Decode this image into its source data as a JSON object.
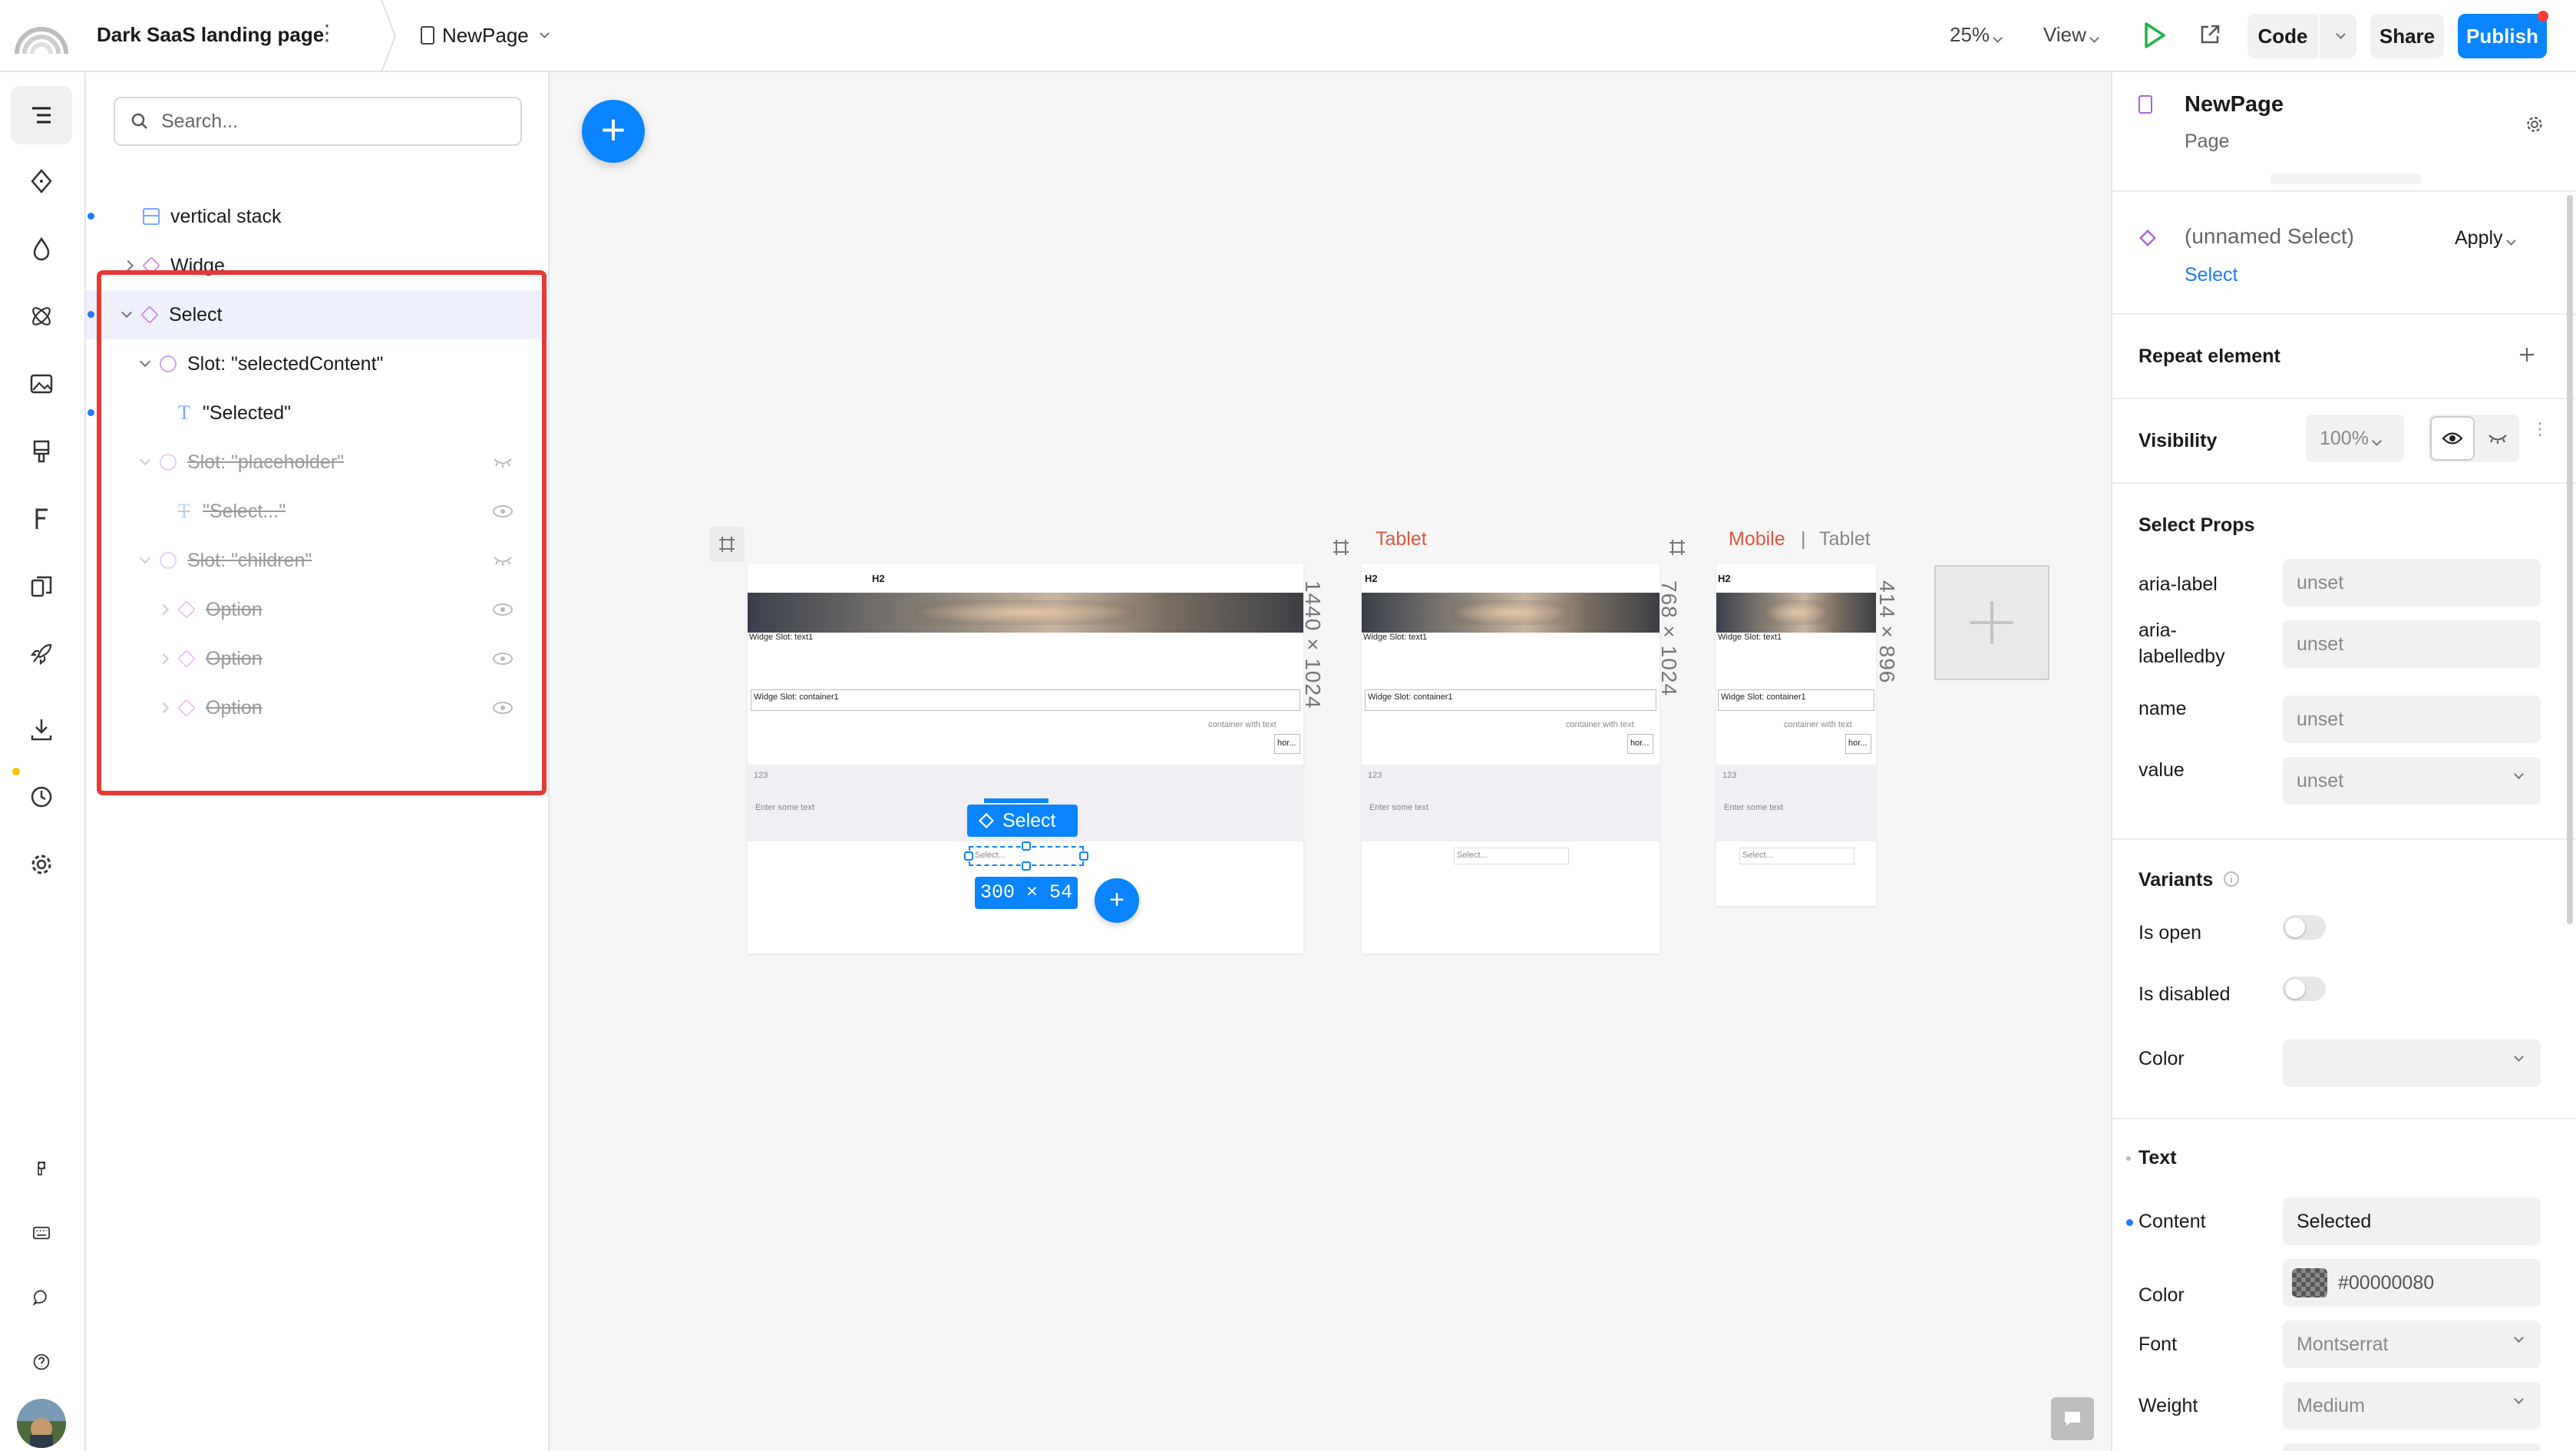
{
  "topbar": {
    "project_title": "Dark SaaS landing page",
    "project_menu": "⋮",
    "page_name": "NewPage",
    "zoom": "25%",
    "view": "View",
    "code": "Code",
    "share": "Share",
    "publish": "Publish",
    "accent": "#0a84ff"
  },
  "layers": {
    "search_placeholder": "Search...",
    "items": [
      {
        "label": "vertical stack"
      },
      {
        "label": "Widge"
      },
      {
        "label": "Select"
      },
      {
        "label": "Slot: \"selectedContent\""
      },
      {
        "label": "\"Selected\""
      },
      {
        "label": "Slot: \"placeholder\""
      },
      {
        "label": "\"Select...\""
      },
      {
        "label": "Slot: \"children\""
      },
      {
        "label": "Option"
      },
      {
        "label": "Option"
      },
      {
        "label": "Option"
      }
    ]
  },
  "canvas": {
    "desktop_size": "1440 × 1024",
    "tablet_size": "768 × 1024",
    "mobile_size": "414 × 896",
    "tablet_label": "Tablet",
    "mobile_label": "Mobile",
    "mobile_sep": "|",
    "mobile_label2": "Tablet",
    "frame": {
      "h2": "H2",
      "slot_text": "Widge Slot: text1",
      "slot_container": "Widge Slot: container1",
      "container_text": "container with text",
      "hor": "hor...",
      "num": "123",
      "enter_text": "Enter some text",
      "select_placeholder": "Select..."
    },
    "selection_tag": "Select",
    "selection_dims": "300 × 54"
  },
  "props": {
    "page_title": "NewPage",
    "page_sub": "Page",
    "component_name": "(unnamed Select)",
    "component_type": "Select",
    "apply": "Apply",
    "repeat_element": "Repeat element",
    "visibility": "Visibility",
    "visibility_value": "100%",
    "select_props": "Select Props",
    "aria_label": "aria-label",
    "aria_labelledby": "aria-\nlabelledby",
    "name": "name",
    "value": "value",
    "unset": "unset",
    "variants": "Variants",
    "is_open": "Is open",
    "is_disabled": "Is disabled",
    "color": "Color",
    "text": "Text",
    "content": "Content",
    "content_value": "Selected",
    "text_color": "Color",
    "text_color_value": "#00000080",
    "font": "Font",
    "font_value": "Montserrat",
    "weight": "Weight",
    "weight_value": "Medium"
  }
}
